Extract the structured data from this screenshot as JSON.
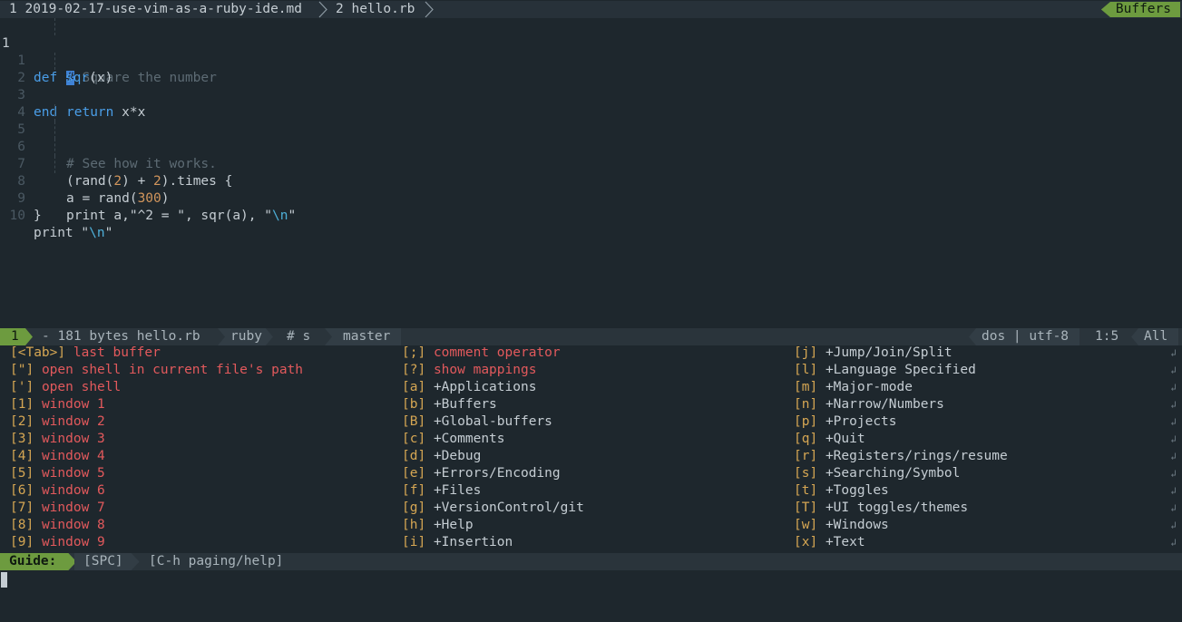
{
  "tabline": {
    "tab1": "1 2019-02-17-use-vim-as-a-ruby-ide.md",
    "tab2": "2 hello.rb",
    "buffers_badge": "Buffers"
  },
  "editor": {
    "current_line_number": "1",
    "first_comment": "Square the number",
    "first_comment_hash": "#",
    "lines": [
      {
        "ln": "1",
        "text": "def sqr(x)"
      },
      {
        "ln": "2",
        "text": "return x*x"
      },
      {
        "ln": "3",
        "text": "end"
      },
      {
        "ln": "4",
        "text": ""
      },
      {
        "ln": "5",
        "text": "# See how it works."
      },
      {
        "ln": "6",
        "text": "(rand(2) + 2).times {"
      },
      {
        "ln": "7",
        "text": "a = rand(300)"
      },
      {
        "ln": "8",
        "text": "print a,\"^2 = \", sqr(a), \"\\n\""
      },
      {
        "ln": "9",
        "text": "}"
      },
      {
        "ln": "10",
        "text": "print \"\\n\""
      }
    ]
  },
  "statusline": {
    "window_number": "1",
    "file_info": "- 181 bytes hello.rb",
    "filetype": "ruby",
    "section": "# s",
    "branch": "master",
    "fileformat_encoding": "dos | utf-8",
    "position": "1:5",
    "scroll": "All"
  },
  "guide": {
    "col1": [
      {
        "key": "[<Tab>]",
        "desc": "last buffer",
        "type": "red"
      },
      {
        "key": "[\"]",
        "desc": "open shell in current file's path",
        "type": "red"
      },
      {
        "key": "[']",
        "desc": "open shell",
        "type": "red"
      },
      {
        "key": "[1]",
        "desc": "window 1",
        "type": "red"
      },
      {
        "key": "[2]",
        "desc": "window 2",
        "type": "red"
      },
      {
        "key": "[3]",
        "desc": "window 3",
        "type": "red"
      },
      {
        "key": "[4]",
        "desc": "window 4",
        "type": "red"
      },
      {
        "key": "[5]",
        "desc": "window 5",
        "type": "red"
      },
      {
        "key": "[6]",
        "desc": "window 6",
        "type": "red"
      },
      {
        "key": "[7]",
        "desc": "window 7",
        "type": "red"
      },
      {
        "key": "[8]",
        "desc": "window 8",
        "type": "red"
      },
      {
        "key": "[9]",
        "desc": "window 9",
        "type": "red"
      }
    ],
    "col2": [
      {
        "key": "[;]",
        "desc": "comment operator",
        "type": "red"
      },
      {
        "key": "[?]",
        "desc": "show mappings",
        "type": "red"
      },
      {
        "key": "[a]",
        "desc": "+Applications",
        "type": "plus"
      },
      {
        "key": "[b]",
        "desc": "+Buffers",
        "type": "plus"
      },
      {
        "key": "[B]",
        "desc": "+Global-buffers",
        "type": "plus"
      },
      {
        "key": "[c]",
        "desc": "+Comments",
        "type": "plus"
      },
      {
        "key": "[d]",
        "desc": "+Debug",
        "type": "plus"
      },
      {
        "key": "[e]",
        "desc": "+Errors/Encoding",
        "type": "plus"
      },
      {
        "key": "[f]",
        "desc": "+Files",
        "type": "plus"
      },
      {
        "key": "[g]",
        "desc": "+VersionControl/git",
        "type": "plus"
      },
      {
        "key": "[h]",
        "desc": "+Help",
        "type": "plus"
      },
      {
        "key": "[i]",
        "desc": "+Insertion",
        "type": "plus"
      }
    ],
    "col3": [
      {
        "key": "[j]",
        "desc": "+Jump/Join/Split",
        "type": "plus"
      },
      {
        "key": "[l]",
        "desc": "+Language Specified",
        "type": "plus"
      },
      {
        "key": "[m]",
        "desc": "+Major-mode",
        "type": "plus"
      },
      {
        "key": "[n]",
        "desc": "+Narrow/Numbers",
        "type": "plus"
      },
      {
        "key": "[p]",
        "desc": "+Projects",
        "type": "plus"
      },
      {
        "key": "[q]",
        "desc": "+Quit",
        "type": "plus"
      },
      {
        "key": "[r]",
        "desc": "+Registers/rings/resume",
        "type": "plus"
      },
      {
        "key": "[s]",
        "desc": "+Searching/Symbol",
        "type": "plus"
      },
      {
        "key": "[t]",
        "desc": "+Toggles",
        "type": "plus"
      },
      {
        "key": "[T]",
        "desc": "+UI toggles/themes",
        "type": "plus"
      },
      {
        "key": "[w]",
        "desc": "+Windows",
        "type": "plus"
      },
      {
        "key": "[x]",
        "desc": "+Text",
        "type": "plus"
      }
    ],
    "label": "Guide:",
    "prefix": "[SPC]",
    "paging": "[C-h paging/help]"
  },
  "colors": {
    "background": "#1e272d",
    "accent_green": "#6d9b3f",
    "keyword_blue": "#4a9ee8",
    "number_orange": "#d1955c",
    "red": "#e2595c",
    "key_yellow": "#d5a653"
  }
}
